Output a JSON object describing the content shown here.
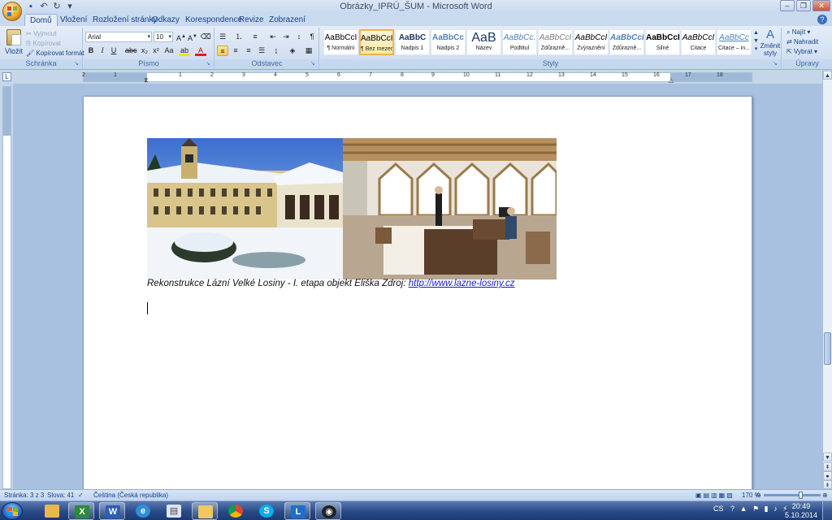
{
  "window": {
    "title": "Obrázky_IPRÚ_ŠUM - Microsoft Word"
  },
  "ribbon_tabs": [
    "Domů",
    "Vložení",
    "Rozložení stránky",
    "Odkazy",
    "Korespondence",
    "Revize",
    "Zobrazení"
  ],
  "clipboard": {
    "paste": "Vložit",
    "cut": "Vyjmout",
    "copy": "Kopírovat",
    "format_painter": "Kopírovat formát",
    "label": "Schránka"
  },
  "font": {
    "name": "Arial",
    "size": "10",
    "label": "Písmo"
  },
  "paragraph": {
    "label": "Odstavec"
  },
  "styles": {
    "label": "Styly",
    "items": [
      {
        "sample": "AaBbCcI",
        "name": "¶ Normální"
      },
      {
        "sample": "AaBbCcI",
        "name": "¶ Bez mezer"
      },
      {
        "sample": "AaBbC",
        "name": "Nadpis 1"
      },
      {
        "sample": "AaBbCc",
        "name": "Nadpis 2"
      },
      {
        "sample": "AaB",
        "name": "Název"
      },
      {
        "sample": "AaBbCc.",
        "name": "Podtitul"
      },
      {
        "sample": "AaBbCcI",
        "name": "Zdůrazně..."
      },
      {
        "sample": "AaBbCcI",
        "name": "Zvýraznění"
      },
      {
        "sample": "AaBbCcI",
        "name": "Zdůrazně..."
      },
      {
        "sample": "AaBbCcI",
        "name": "Silné"
      },
      {
        "sample": "AaBbCcI",
        "name": "Citace"
      },
      {
        "sample": "AaBbCc",
        "name": "Citace – in..."
      }
    ],
    "change_styles": "Změnit styly"
  },
  "editing": {
    "find": "Najít",
    "replace": "Nahradit",
    "select": "Vybrat",
    "label": "Úpravy"
  },
  "document": {
    "caption_text": "Rekonstrukce Lázní Velké Losiny - I. etapa objekt Eliška   Zdroj: ",
    "caption_link": "http://www.lazne-losiny.cz"
  },
  "ruler_numbers": [
    "2",
    "1",
    "1",
    "2",
    "3",
    "4",
    "5",
    "6",
    "7",
    "8",
    "9",
    "10",
    "11",
    "12",
    "13",
    "14",
    "15",
    "16",
    "17",
    "18"
  ],
  "statusbar": {
    "page": "Stránka: 3 z 3",
    "words": "Slova: 41",
    "language": "Čeština (Česká republika)",
    "zoom": "170 %"
  },
  "taskbar": {
    "language": "CS",
    "time": "20:49",
    "date": "5.10.2014"
  },
  "colors": {
    "accent": "#15428b",
    "link": "#1a1ad8",
    "selected_style": "#f2b24a"
  }
}
